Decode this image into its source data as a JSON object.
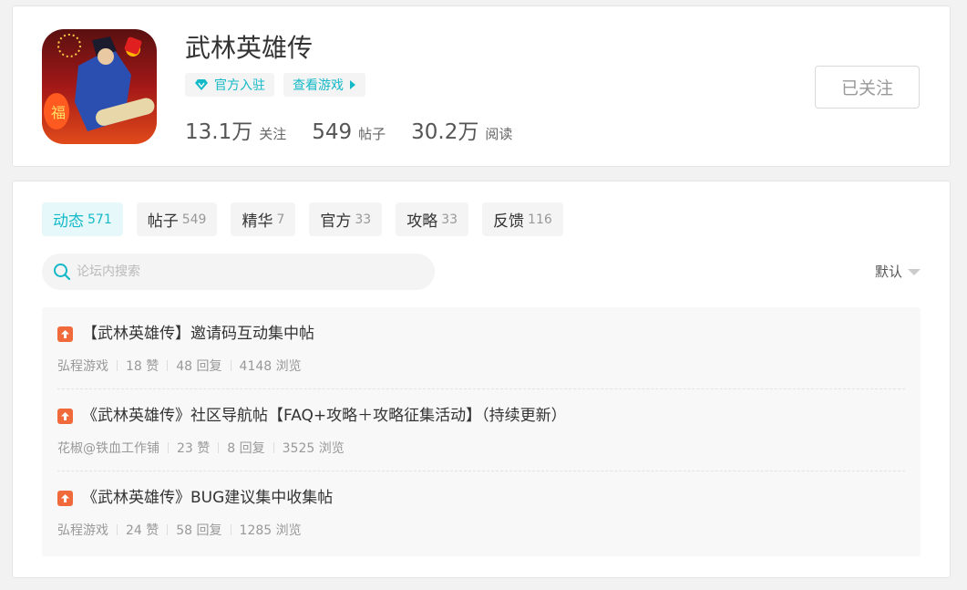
{
  "game": {
    "title": "武林英雄传",
    "official_badge": "官方入驻",
    "view_game": "查看游戏",
    "stats": [
      {
        "num": "13.1万",
        "label": "关注"
      },
      {
        "num": "549",
        "label": "帖子"
      },
      {
        "num": "30.2万",
        "label": "阅读"
      }
    ],
    "follow_label": "已关注"
  },
  "tabs": [
    {
      "label": "动态",
      "count": "571",
      "active": true
    },
    {
      "label": "帖子",
      "count": "549"
    },
    {
      "label": "精华",
      "count": "7"
    },
    {
      "label": "官方",
      "count": "33"
    },
    {
      "label": "攻略",
      "count": "33"
    },
    {
      "label": "反馈",
      "count": "116"
    }
  ],
  "search": {
    "placeholder": "论坛内搜索"
  },
  "sort": {
    "label": "默认"
  },
  "posts": [
    {
      "title": "【武林英雄传】邀请码互动集中帖",
      "author": "弘程游戏",
      "likes": "18 赞",
      "replies": "48 回复",
      "views": "4148 浏览"
    },
    {
      "title": "《武林英雄传》社区导航帖【FAQ+攻略＋攻略征集活动】（持续更新）",
      "author": "花椒@铁血工作铺",
      "likes": "23 赞",
      "replies": "8 回复",
      "views": "3525 浏览"
    },
    {
      "title": "《武林英雄传》BUG建议集中收集帖",
      "author": "弘程游戏",
      "likes": "24 赞",
      "replies": "58 回复",
      "views": "1285 浏览"
    }
  ],
  "colors": {
    "accent": "#14b9c8",
    "top_icon": "#f06a3c"
  }
}
